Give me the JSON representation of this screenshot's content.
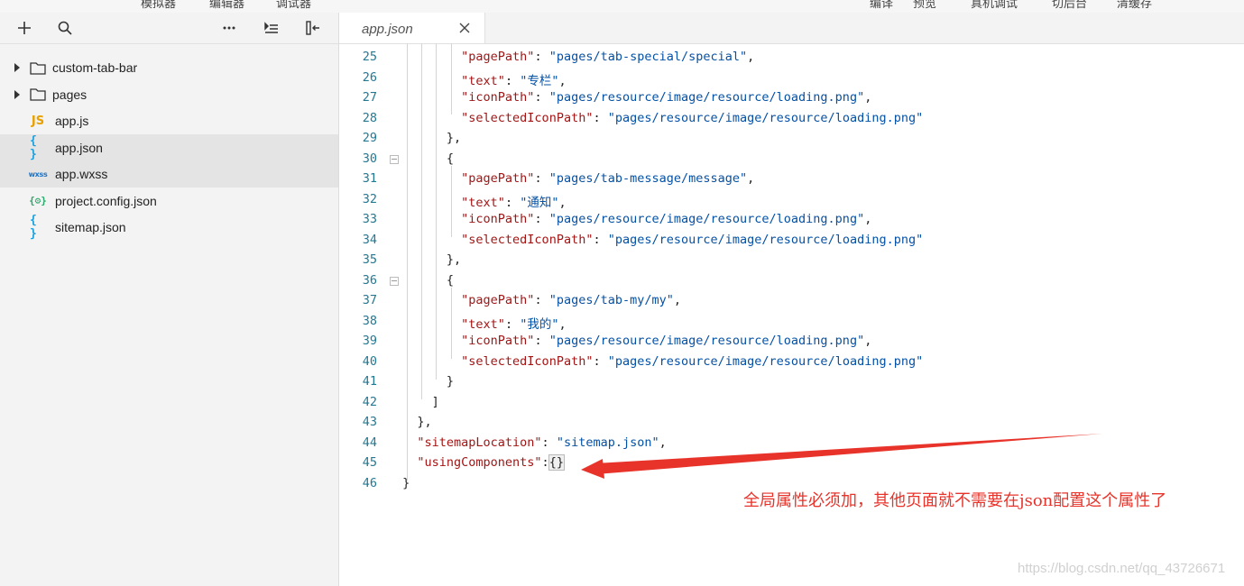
{
  "menu_bar": {
    "items": [
      "模拟器",
      "编辑器",
      "调试器",
      "编译",
      "预览",
      "真机调试",
      "切后台",
      "清缓存"
    ]
  },
  "toolbar": {
    "icons": [
      "plus-icon",
      "search-icon",
      "more-icon",
      "collapse-icon",
      "layout-icon"
    ]
  },
  "file_tree": [
    {
      "type": "folder",
      "label": "custom-tab-bar"
    },
    {
      "type": "folder",
      "label": "pages"
    },
    {
      "type": "js",
      "icon_text": "JS",
      "label": "app.js"
    },
    {
      "type": "json",
      "icon_text": "{ }",
      "label": "app.json"
    },
    {
      "type": "wxss",
      "icon_text": "wxss",
      "label": "app.wxss"
    },
    {
      "type": "config",
      "icon_text": "{⚙}",
      "label": "project.config.json"
    },
    {
      "type": "json",
      "icon_text": "{ }",
      "label": "sitemap.json"
    }
  ],
  "editor": {
    "tab": {
      "name": "app.json"
    },
    "lines": [
      {
        "num": "25",
        "k": "\"pagePath\"",
        "s": "\"pages/tab-special/special\"",
        "tail": ","
      },
      {
        "num": "26",
        "k": "\"text\"",
        "s": "\"专栏\"",
        "tail": ","
      },
      {
        "num": "27",
        "k": "\"iconPath\"",
        "s": "\"pages/resource/image/resource/loading.png\"",
        "tail": ","
      },
      {
        "num": "28",
        "k": "\"selectedIconPath\"",
        "s": "\"pages/resource/image/resource/loading.png\"",
        "tail": ""
      },
      {
        "num": "29",
        "text": "},"
      },
      {
        "num": "30",
        "text": "{"
      },
      {
        "num": "31",
        "k": "\"pagePath\"",
        "s": "\"pages/tab-message/message\"",
        "tail": ","
      },
      {
        "num": "32",
        "k": "\"text\"",
        "s": "\"通知\"",
        "tail": ","
      },
      {
        "num": "33",
        "k": "\"iconPath\"",
        "s": "\"pages/resource/image/resource/loading.png\"",
        "tail": ","
      },
      {
        "num": "34",
        "k": "\"selectedIconPath\"",
        "s": "\"pages/resource/image/resource/loading.png\"",
        "tail": ""
      },
      {
        "num": "35",
        "text": "},"
      },
      {
        "num": "36",
        "text": "{"
      },
      {
        "num": "37",
        "k": "\"pagePath\"",
        "s": "\"pages/tab-my/my\"",
        "tail": ","
      },
      {
        "num": "38",
        "k": "\"text\"",
        "s": "\"我的\"",
        "tail": ","
      },
      {
        "num": "39",
        "k": "\"iconPath\"",
        "s": "\"pages/resource/image/resource/loading.png\"",
        "tail": ","
      },
      {
        "num": "40",
        "k": "\"selectedIconPath\"",
        "s": "\"pages/resource/image/resource/loading.png\"",
        "tail": ""
      },
      {
        "num": "41",
        "text": "}"
      },
      {
        "num": "42",
        "text": "]"
      },
      {
        "num": "43",
        "text": "},"
      },
      {
        "num": "44",
        "k": "\"sitemapLocation\"",
        "s": "\"sitemap.json\"",
        "tail": ","
      },
      {
        "num": "45",
        "k": "\"usingComponents\"",
        "s": "",
        "tail": "",
        "bracket": "{}"
      },
      {
        "num": "46",
        "text": "}"
      }
    ]
  },
  "annotation": {
    "text": "全局属性必须加，其他页面就不需要在json配置这个属性了",
    "color": "#e8332a"
  },
  "watermark": {
    "text": "https://blog.csdn.net/qq_43726671"
  }
}
